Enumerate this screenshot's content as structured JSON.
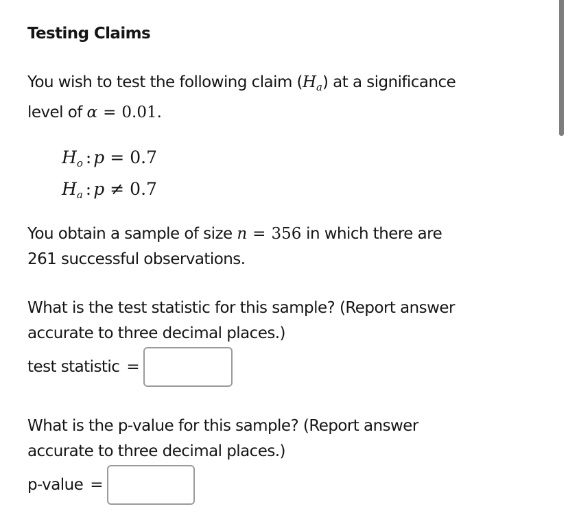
{
  "title": "Testing Claims",
  "intro": {
    "text_before": "You wish to test the following claim (",
    "claim_symbol": "H",
    "claim_subscript": "a",
    "text_after": ") at a significance",
    "line2_text": "level of ",
    "alpha_symbol": "α",
    "equals": "=",
    "alpha_value": "0.01."
  },
  "hypotheses": {
    "null": {
      "symbol": "H",
      "subscript": "o",
      "colon": ":",
      "param": "p",
      "relation": "=",
      "value": "0.7"
    },
    "alternative": {
      "symbol": "H",
      "subscript": "a",
      "colon": ":",
      "param": "p",
      "relation": "≠",
      "value": "0.7"
    }
  },
  "sample": {
    "text_before": "You obtain a sample of size ",
    "n_symbol": "n",
    "equals": "=",
    "n_value": "356",
    "text_after": " in which there are",
    "line2": "261 successful observations."
  },
  "question_test_statistic": {
    "line1": "What is the test statistic for this sample? (Report answer",
    "line2": "accurate to three decimal places.)",
    "label": "test statistic",
    "equals": "=",
    "value": "",
    "placeholder": ""
  },
  "question_p_value": {
    "line1": "What is the p-value for this sample? (Report answer",
    "line2": "accurate to three decimal places.)",
    "label": "p-value",
    "equals": "=",
    "value": "",
    "placeholder": ""
  }
}
